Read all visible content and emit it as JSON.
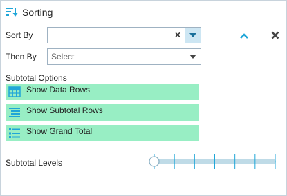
{
  "panel": {
    "title": "Sorting",
    "icon": "sort-icon"
  },
  "sort_by": {
    "label": "Sort By",
    "value": "",
    "clear_icon": "close-icon",
    "dropdown_icon": "chevron-down-icon"
  },
  "then_by": {
    "label": "Then By",
    "placeholder": "Select",
    "dropdown_icon": "chevron-down-icon"
  },
  "actions": {
    "collapse_icon": "chevron-up-icon",
    "remove_icon": "close-icon"
  },
  "subtotal": {
    "heading": "Subtotal Options",
    "options": [
      {
        "label": "Show Data Rows",
        "icon": "grid-icon"
      },
      {
        "label": "Show Subtotal Rows",
        "icon": "list-lines-icon"
      },
      {
        "label": "Show Grand Total",
        "icon": "bullet-list-icon"
      }
    ],
    "option_color": "#98eec4"
  },
  "levels": {
    "label": "Subtotal Levels",
    "value": 0,
    "tick_count": 7
  },
  "colors": {
    "accent": "#1fa6d8",
    "slider_track": "#bfdbe7"
  }
}
